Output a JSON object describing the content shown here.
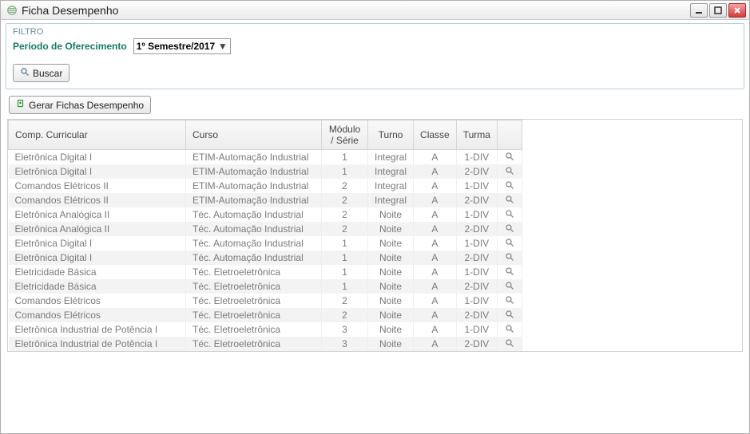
{
  "window": {
    "title": "Ficha Desempenho"
  },
  "filter": {
    "legend": "FILTRO",
    "period_label": "Período de Oferecimento",
    "period_value": "1º Semestre/2017",
    "buscar_label": "Buscar"
  },
  "actions": {
    "gerar_label": "Gerar Fichas Desempenho"
  },
  "grid": {
    "headers": {
      "comp": "Comp. Curricular",
      "curso": "Curso",
      "modulo": "Módulo / Série",
      "turno": "Turno",
      "classe": "Classe",
      "turma": "Turma"
    },
    "rows": [
      {
        "comp": "Eletrônica Digital I",
        "curso": "ETIM-Automação Industrial",
        "mod": "1",
        "turno": "Integral",
        "classe": "A",
        "turma": "1-DIV"
      },
      {
        "comp": "Eletrônica Digital I",
        "curso": "ETIM-Automação Industrial",
        "mod": "1",
        "turno": "Integral",
        "classe": "A",
        "turma": "2-DIV"
      },
      {
        "comp": "Comandos Elétricos II",
        "curso": "ETIM-Automação Industrial",
        "mod": "2",
        "turno": "Integral",
        "classe": "A",
        "turma": "1-DIV"
      },
      {
        "comp": "Comandos Elétricos II",
        "curso": "ETIM-Automação Industrial",
        "mod": "2",
        "turno": "Integral",
        "classe": "A",
        "turma": "2-DIV"
      },
      {
        "comp": "Eletrônica Analógica II",
        "curso": "Téc. Automação Industrial",
        "mod": "2",
        "turno": "Noite",
        "classe": "A",
        "turma": "1-DIV"
      },
      {
        "comp": "Eletrônica Analógica II",
        "curso": "Téc. Automação Industrial",
        "mod": "2",
        "turno": "Noite",
        "classe": "A",
        "turma": "2-DIV"
      },
      {
        "comp": "Eletrônica Digital I",
        "curso": "Téc. Automação Industrial",
        "mod": "1",
        "turno": "Noite",
        "classe": "A",
        "turma": "1-DIV"
      },
      {
        "comp": "Eletrônica Digital I",
        "curso": "Téc. Automação Industrial",
        "mod": "1",
        "turno": "Noite",
        "classe": "A",
        "turma": "2-DIV"
      },
      {
        "comp": "Eletricidade Básica",
        "curso": "Téc. Eletroeletrônica",
        "mod": "1",
        "turno": "Noite",
        "classe": "A",
        "turma": "1-DIV"
      },
      {
        "comp": "Eletricidade Básica",
        "curso": "Téc. Eletroeletrônica",
        "mod": "1",
        "turno": "Noite",
        "classe": "A",
        "turma": "2-DIV"
      },
      {
        "comp": "Comandos Elétricos",
        "curso": "Téc. Eletroeletrônica",
        "mod": "2",
        "turno": "Noite",
        "classe": "A",
        "turma": "1-DIV"
      },
      {
        "comp": "Comandos Elétricos",
        "curso": "Téc. Eletroeletrônica",
        "mod": "2",
        "turno": "Noite",
        "classe": "A",
        "turma": "2-DIV"
      },
      {
        "comp": "Eletrônica Industrial de Potência I",
        "curso": "Téc. Eletroeletrônica",
        "mod": "3",
        "turno": "Noite",
        "classe": "A",
        "turma": "1-DIV"
      },
      {
        "comp": "Eletrônica Industrial de Potência I",
        "curso": "Téc. Eletroeletrônica",
        "mod": "3",
        "turno": "Noite",
        "classe": "A",
        "turma": "2-DIV"
      }
    ]
  }
}
